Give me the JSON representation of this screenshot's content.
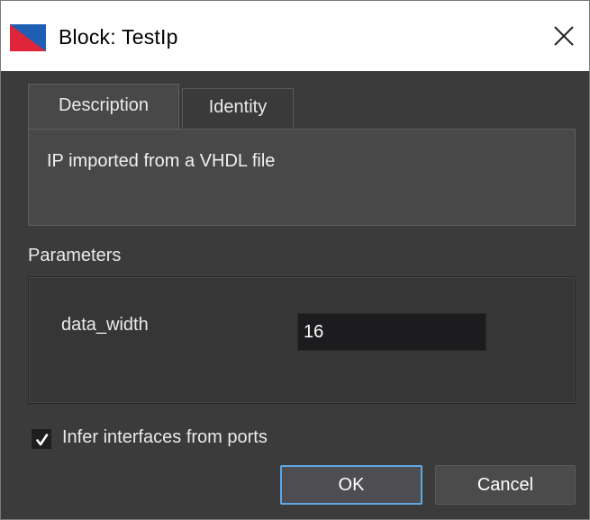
{
  "window": {
    "title": "Block: TestIp",
    "icon": "app-logo-icon",
    "close_icon": "close-icon"
  },
  "tabs": [
    {
      "label": "Description",
      "selected": true
    },
    {
      "label": "Identity",
      "selected": false
    }
  ],
  "description": {
    "text": "IP imported from a VHDL file"
  },
  "parameters": {
    "label": "Parameters",
    "items": [
      {
        "name": "data_width",
        "value": "16"
      }
    ]
  },
  "options": {
    "infer_interfaces": {
      "label": "Infer interfaces from ports",
      "checked": true
    }
  },
  "buttons": {
    "ok": "OK",
    "cancel": "Cancel"
  },
  "colors": {
    "background": "#3b3b3b",
    "panel": "#484848",
    "input": "#1c1c1f",
    "focus_border": "#5fa8e6",
    "logo_blue": "#1e5fb4",
    "logo_red": "#e0243a"
  }
}
